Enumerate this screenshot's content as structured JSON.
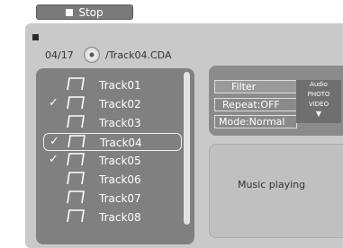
{
  "toolbar": {
    "stop_label": "Stop"
  },
  "now_playing": {
    "track_index": "04/17",
    "path": "/Track04.CDA"
  },
  "tracks": [
    {
      "label": "Track01",
      "checked": false,
      "selected": false
    },
    {
      "label": "Track02",
      "checked": true,
      "selected": false
    },
    {
      "label": "Track03",
      "checked": false,
      "selected": false
    },
    {
      "label": "Track04",
      "checked": true,
      "selected": true
    },
    {
      "label": "Track05",
      "checked": true,
      "selected": false
    },
    {
      "label": "Track06",
      "checked": false,
      "selected": false
    },
    {
      "label": "Track07",
      "checked": false,
      "selected": false
    },
    {
      "label": "Track08",
      "checked": false,
      "selected": false
    }
  ],
  "controls": {
    "filter_label": "Filter",
    "repeat_label": "Repeat:OFF",
    "mode_label": "Mode:Normal",
    "filter_options": [
      "Audio",
      "PHOTO",
      "VIDEO"
    ]
  },
  "status": {
    "text": "Music playing"
  },
  "icons": {
    "check": "check-icon",
    "note": "music-note-icon",
    "disc": "disc-icon",
    "stop": "stop-icon"
  }
}
